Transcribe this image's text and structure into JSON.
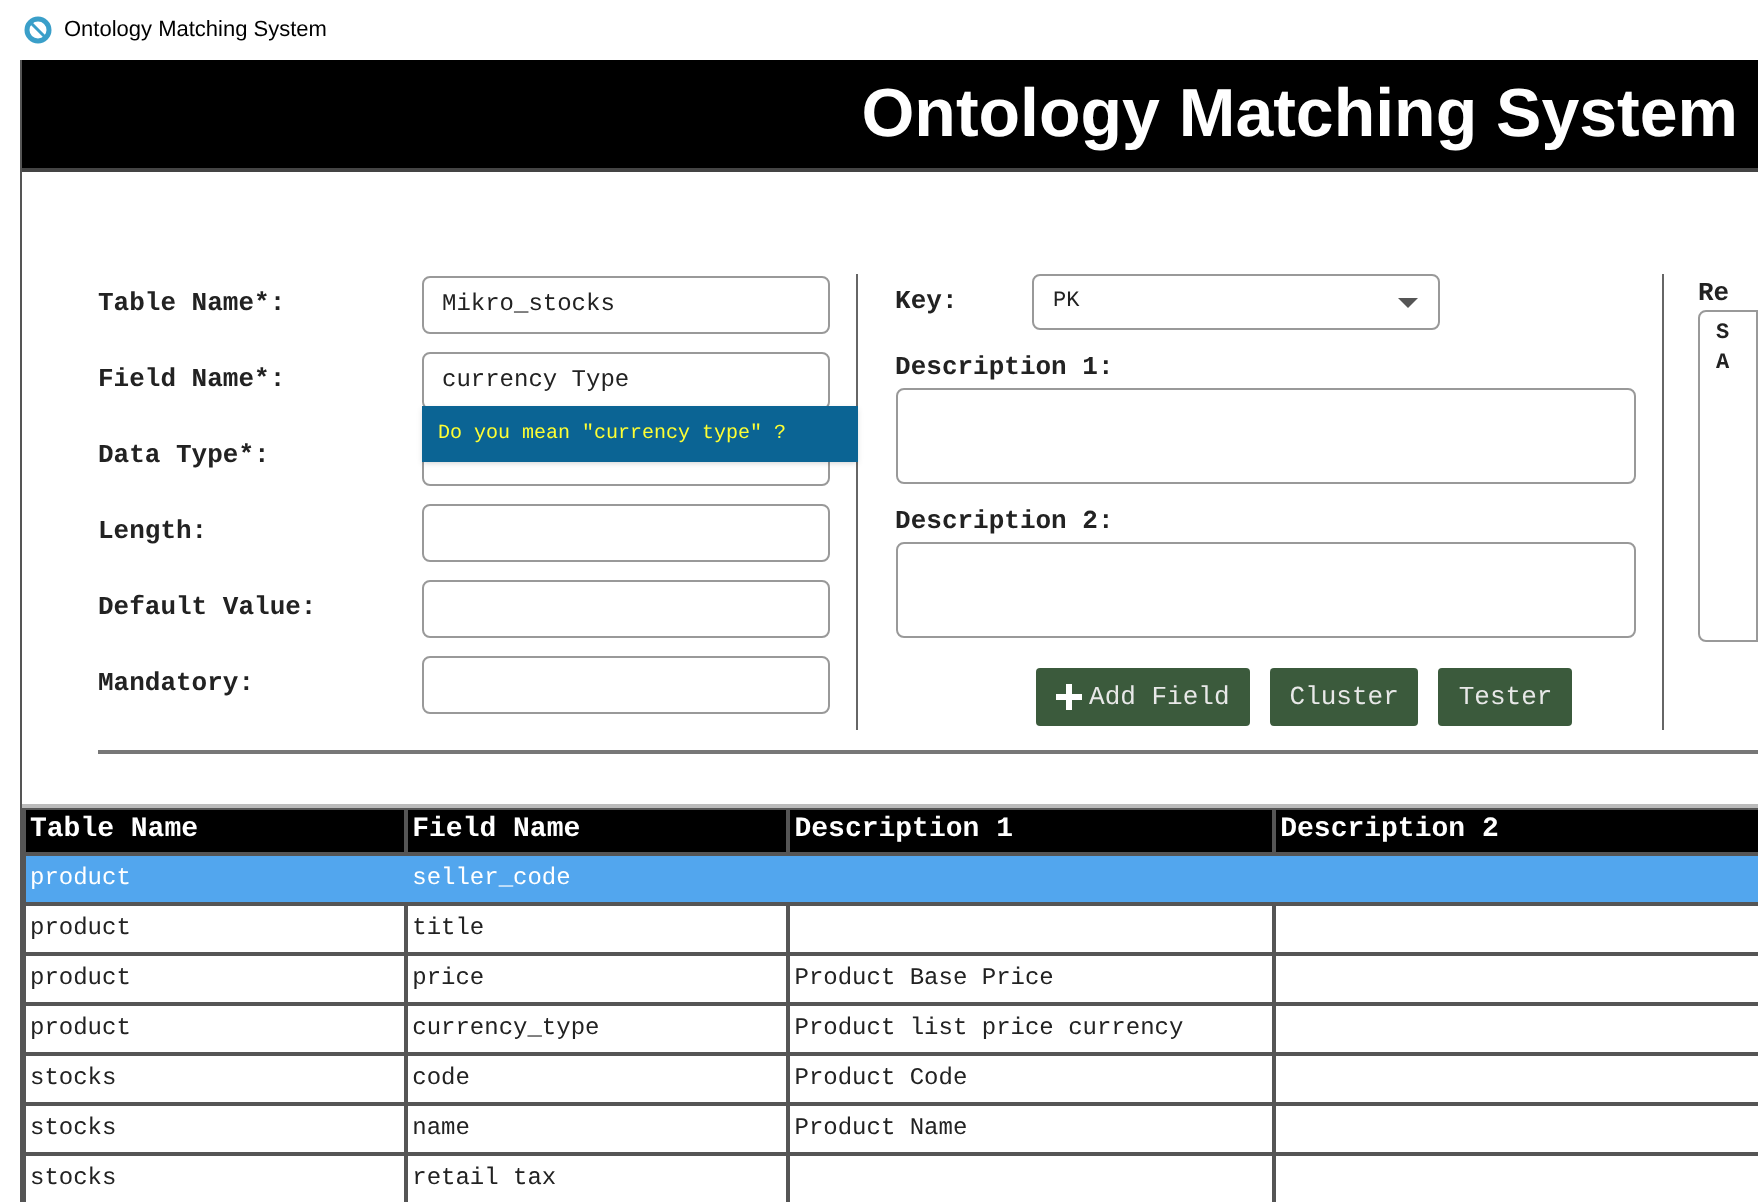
{
  "window": {
    "title": "Ontology Matching System"
  },
  "banner": {
    "title": "Ontology Matching System"
  },
  "form": {
    "fields": [
      {
        "label": "Table Name*:",
        "value": "Mikro_stocks"
      },
      {
        "label": "Field Name*:",
        "value": "currency Type"
      },
      {
        "label": "Data Type*:"
      },
      {
        "label": "Length:"
      },
      {
        "label": "Default Value:"
      },
      {
        "label": "Mandatory:"
      }
    ],
    "suggestion": "Do you mean \"currency type\" ?",
    "key": {
      "label": "Key:",
      "value": "PK"
    },
    "descriptions": [
      {
        "label": "Description 1:"
      },
      {
        "label": "Description 2:"
      }
    ],
    "buttons": [
      {
        "label": "Add Field",
        "kind": "add"
      },
      {
        "label": "Cluster",
        "kind": "plain"
      },
      {
        "label": "Tester",
        "kind": "plain"
      }
    ],
    "right_panel": {
      "label": "Re",
      "lines": [
        "S",
        "A"
      ]
    }
  },
  "table": {
    "columns": [
      "Table Name",
      "Field Name",
      "Description 1",
      "Description 2"
    ],
    "rows": [
      {
        "cells": [
          "product",
          "seller_code",
          "",
          ""
        ],
        "selected": true
      },
      {
        "cells": [
          "product",
          "title",
          "",
          ""
        ],
        "selected": false
      },
      {
        "cells": [
          "product",
          "price",
          "Product Base Price",
          ""
        ],
        "selected": false
      },
      {
        "cells": [
          "product",
          "currency_type",
          "Product list price currency",
          ""
        ],
        "selected": false
      },
      {
        "cells": [
          "stocks",
          "code",
          "Product Code",
          ""
        ],
        "selected": false
      },
      {
        "cells": [
          "stocks",
          "name",
          "Product Name",
          ""
        ],
        "selected": false
      },
      {
        "cells": [
          "stocks",
          "retail tax",
          "",
          ""
        ],
        "selected": false
      }
    ]
  }
}
